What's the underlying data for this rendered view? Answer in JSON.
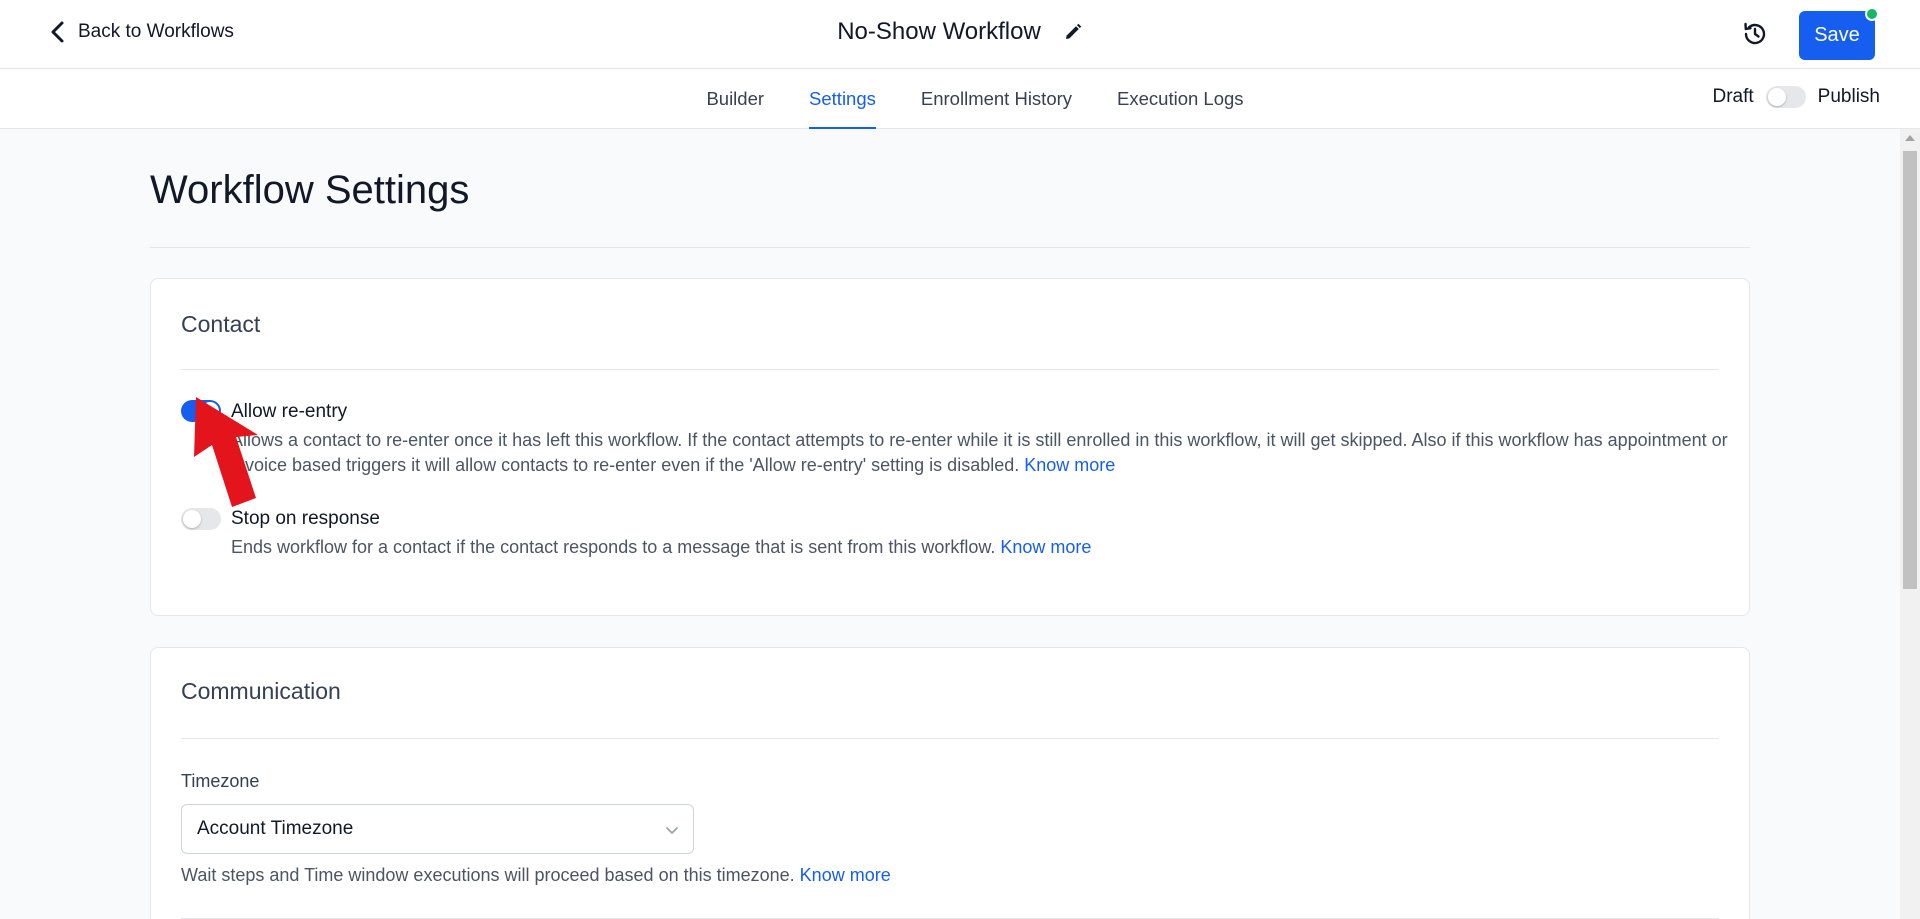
{
  "header": {
    "back_label": "Back to Workflows",
    "title": "No-Show Workflow",
    "save_label": "Save"
  },
  "tabs": [
    {
      "label": "Builder",
      "active": false
    },
    {
      "label": "Settings",
      "active": true
    },
    {
      "label": "Enrollment History",
      "active": false
    },
    {
      "label": "Execution Logs",
      "active": false
    }
  ],
  "publish": {
    "draft_label": "Draft",
    "publish_label": "Publish",
    "published": false
  },
  "page": {
    "title": "Workflow Settings"
  },
  "contact_card": {
    "title": "Contact",
    "options": [
      {
        "label": "Allow re-entry",
        "enabled": true,
        "description": "Allows a contact to re-enter once it has left this workflow. If the contact attempts to re-enter while it is still enrolled in this workflow, it will get skipped. Also if this workflow has appointment or invoice based triggers it will allow contacts to re-enter even if the 'Allow re-entry' setting is disabled.",
        "link": "Know more"
      },
      {
        "label": "Stop on response",
        "enabled": false,
        "description": "Ends workflow for a contact if the contact responds to a message that is sent from this workflow.",
        "link": "Know more"
      }
    ]
  },
  "communication_card": {
    "title": "Communication",
    "timezone_label": "Timezone",
    "timezone_value": "Account Timezone",
    "timezone_help": "Wait steps and Time window executions will proceed based on this timezone.",
    "timezone_link": "Know more"
  },
  "colors": {
    "accent": "#155eef",
    "status_dot": "#12b76a",
    "annotation": "#e3141c"
  },
  "icons": [
    "chevron-left-icon",
    "pencil-icon",
    "history-icon",
    "chevron-down-icon",
    "red-arrow-annotation"
  ]
}
